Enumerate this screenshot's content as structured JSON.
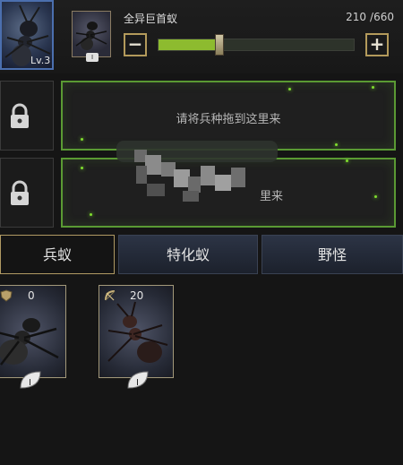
{
  "header": {
    "lead_level": "Lv.3",
    "unit_name": "全异巨首蚁",
    "count_current": "210",
    "count_max": "/660",
    "minus_label": "−",
    "plus_label": "+",
    "slider_fraction": 0.31,
    "sub_tier": "I"
  },
  "slots": [
    {
      "text": "请将兵种拖到这里来"
    },
    {
      "text": "里来"
    }
  ],
  "tabs": [
    {
      "label": "兵蚁",
      "active": true
    },
    {
      "label": "特化蚁",
      "active": false
    },
    {
      "label": "野怪",
      "active": false
    }
  ],
  "units": [
    {
      "count": "0",
      "tier": "I",
      "icon": "shield-icon"
    },
    {
      "count": "20",
      "tier": "I",
      "icon": "bow-icon"
    }
  ],
  "colors": {
    "slot_border": "#5a9a33",
    "slider_fill": "#8dbb2f",
    "accent_gold": "#b39a5b"
  }
}
